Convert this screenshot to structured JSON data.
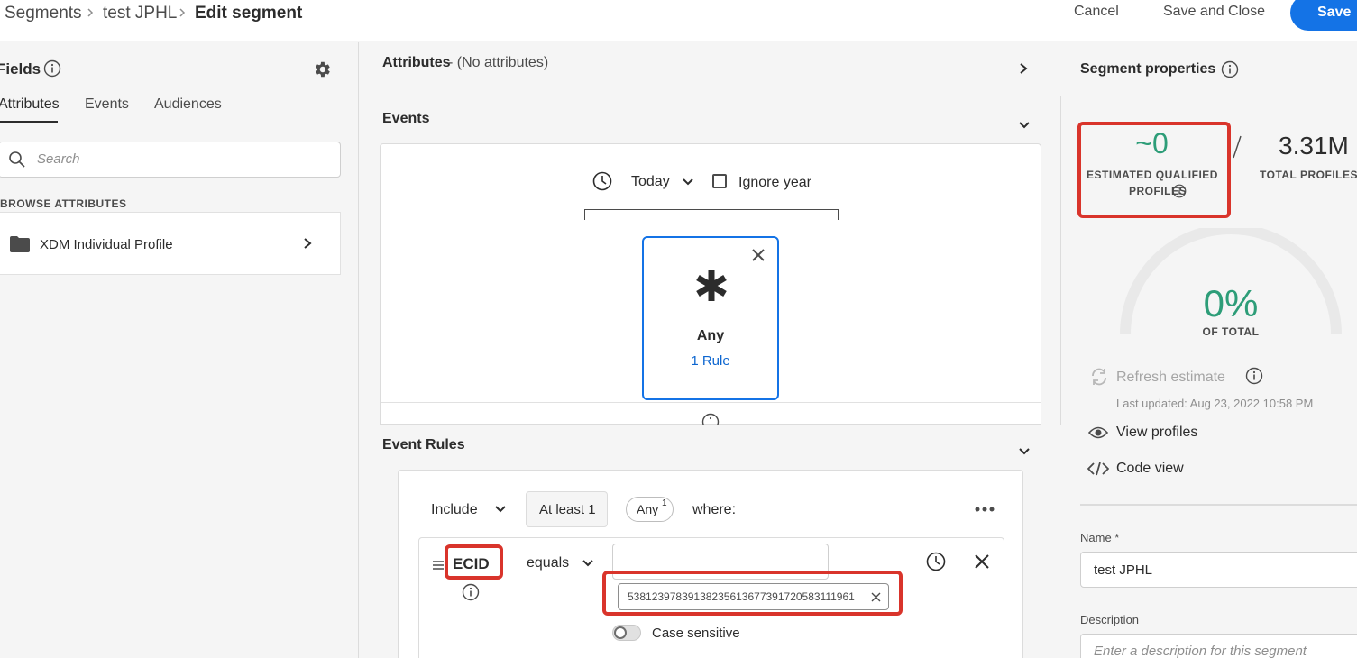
{
  "breadcrumb": {
    "items": [
      "Segments",
      "test JPHL"
    ],
    "current": "Edit segment"
  },
  "header": {
    "cancel_label": "Cancel",
    "save_close_label": "Save and Close",
    "save_label": "Save"
  },
  "fields_panel": {
    "title": "Fields",
    "tabs": [
      "Attributes",
      "Events",
      "Audiences"
    ],
    "active_tab": "Attributes",
    "search_placeholder": "Search",
    "browse_label": "BROWSE ATTRIBUTES",
    "browse_items": [
      {
        "label": "XDM Individual Profile",
        "icon": "folder-icon"
      }
    ]
  },
  "canvas": {
    "attributes": {
      "title": "Attributes",
      "subtitle": " - (No attributes)"
    },
    "events": {
      "title": "Events",
      "time_label": "Today",
      "ignore_year_label": "Ignore year",
      "ignore_year_checked": false,
      "event_card": {
        "symbol": "*",
        "title": "Any",
        "rules_link": "1 Rule"
      }
    },
    "event_rules": {
      "title": "Event Rules",
      "include_label": "Include",
      "count_label": "At least 1",
      "any_badge": "Any",
      "any_superscript": "1",
      "where_label": "where:",
      "rule": {
        "field": "ECID",
        "operator": "equals",
        "input_value": "",
        "tag_value": "53812397839138235613677391720583111961",
        "case_sensitive_label": "Case sensitive",
        "case_sensitive_on": false
      }
    }
  },
  "properties": {
    "title": "Segment properties",
    "estimated_value": "~0",
    "estimated_label_1": "ESTIMATED QUALIFIED",
    "estimated_label_2": "PROFILES",
    "total_value": "3.31M",
    "total_label": "TOTAL PROFILES",
    "percent_value": "0%",
    "percent_label": "OF TOTAL",
    "refresh_label": "Refresh estimate",
    "last_updated": "Last updated: Aug 23, 2022 10:58 PM",
    "view_profiles_label": "View profiles",
    "code_view_label": "Code view",
    "name_label": "Name *",
    "name_value": "test JPHL",
    "description_label": "Description",
    "description_placeholder": "Enter a description for this segment"
  },
  "colors": {
    "accent_blue": "#1473e6",
    "highlight_red": "#d9342b",
    "success_green": "#2d9d78",
    "link_blue": "#0d66d0"
  }
}
